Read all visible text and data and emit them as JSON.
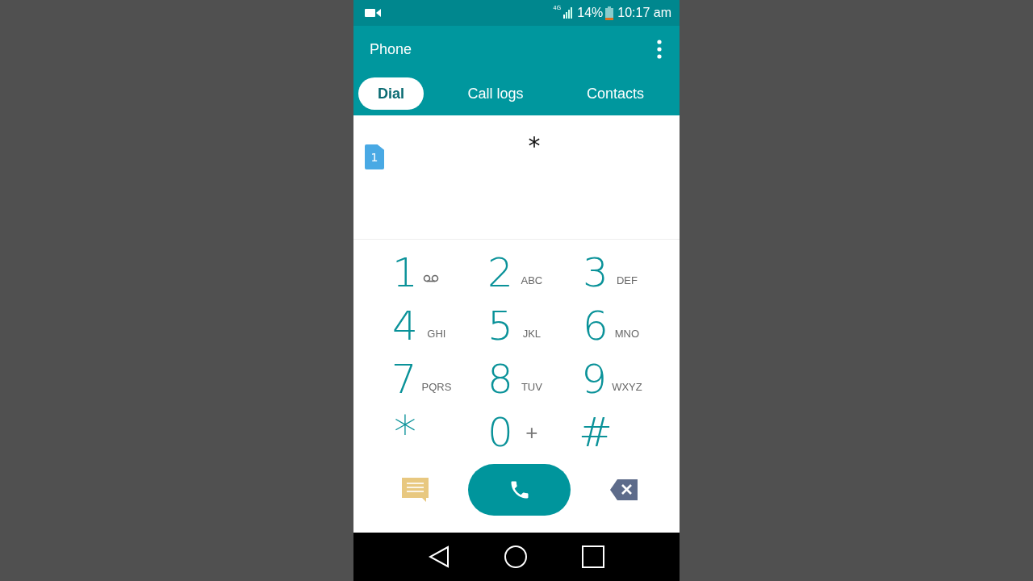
{
  "status_bar": {
    "network": "4G",
    "battery": "14%",
    "time": "10:17 am"
  },
  "header": {
    "title": "Phone"
  },
  "tabs": [
    {
      "label": "Dial",
      "selected": true
    },
    {
      "label": "Call logs",
      "selected": false
    },
    {
      "label": "Contacts",
      "selected": false
    }
  ],
  "dial": {
    "sim": "1",
    "value": "*"
  },
  "keys": [
    {
      "digit": "1",
      "kind": "voicemail"
    },
    {
      "digit": "2",
      "letters": "ABC",
      "kind": "letters"
    },
    {
      "digit": "3",
      "letters": "DEF",
      "kind": "letters"
    },
    {
      "digit": "4",
      "letters": "GHI",
      "kind": "letters"
    },
    {
      "digit": "5",
      "letters": "JKL",
      "kind": "letters"
    },
    {
      "digit": "6",
      "letters": "MNO",
      "kind": "letters"
    },
    {
      "digit": "7",
      "letters": "PQRS",
      "kind": "letters"
    },
    {
      "digit": "8",
      "letters": "TUV",
      "kind": "letters"
    },
    {
      "digit": "9",
      "letters": "WXYZ",
      "kind": "letters"
    },
    {
      "digit": "*",
      "kind": "star"
    },
    {
      "digit": "0",
      "letters": "+",
      "kind": "plus"
    },
    {
      "digit": "#",
      "kind": "plain"
    }
  ]
}
